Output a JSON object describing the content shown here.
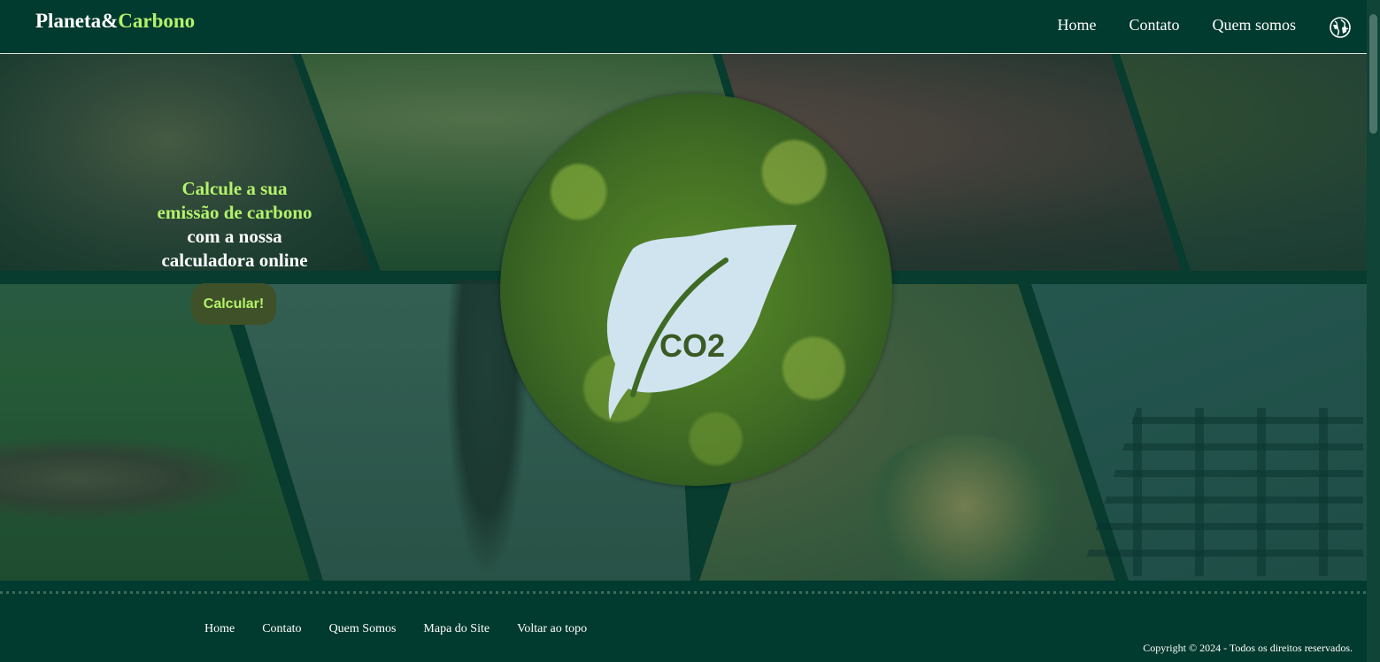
{
  "header": {
    "logo_part1": "Planeta&",
    "logo_part2": "Carbono",
    "nav": [
      "Home",
      "Contato",
      "Quem somos"
    ],
    "globe_icon": "globe-icon"
  },
  "hero": {
    "line1": "Calcule a sua",
    "line2": "emissão de carbono",
    "line3": "com a nossa",
    "line4": "calculadora online",
    "button_label": "Calcular!",
    "circle_text": "CO2"
  },
  "footer": {
    "links": [
      "Home",
      "Contato",
      "Quem Somos",
      "Mapa do Site",
      "Voltar ao topo"
    ],
    "copyright": "Copyright © 2024 - Todos os direitos reservados."
  },
  "colors": {
    "background": "#013a2e",
    "accent": "#b4f26b",
    "button_bg": "#3f5128"
  }
}
